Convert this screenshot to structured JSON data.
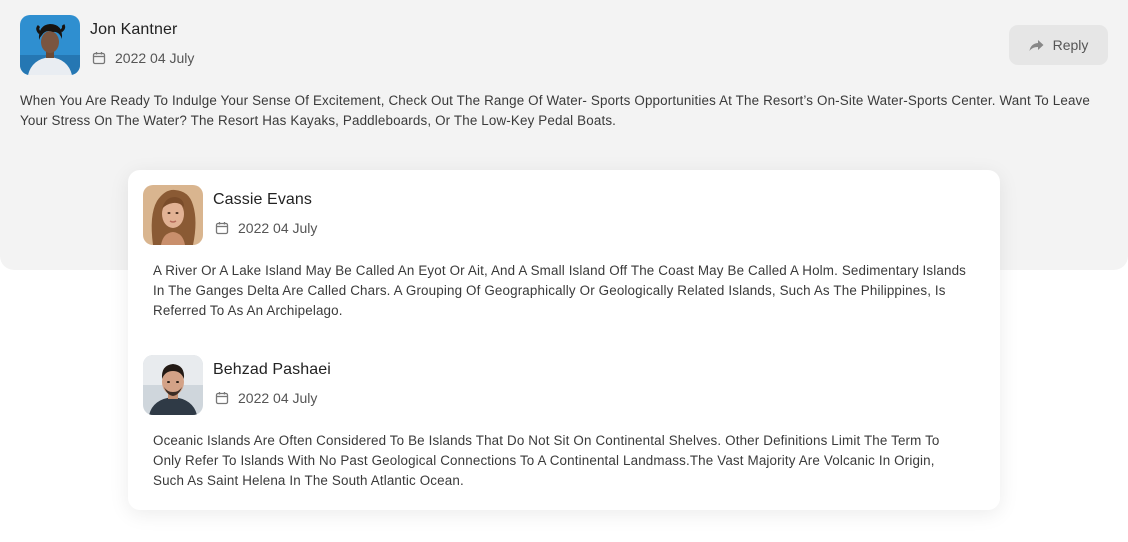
{
  "main_comment": {
    "author": "Jon Kantner",
    "date": "2022 04 July",
    "text": "When You Are Ready To Indulge Your Sense Of Excitement, Check Out The Range Of Water- Sports Opportunities At The Resort’s On-Site Water-Sports Center. Want To Leave Your Stress On The Water? The Resort Has Kayaks, Paddleboards, Or The Low-Key Pedal Boats.",
    "reply_label": "Reply",
    "avatar_icon": "avatar-photo",
    "reply_icon": "share-arrow-icon"
  },
  "replies": [
    {
      "author": "Cassie Evans",
      "date": "2022 04 July",
      "text": "A River Or A Lake Island May Be Called An Eyot Or Ait, And A Small Island Off The Coast May Be Called A Holm. Sedimentary Islands In The Ganges Delta Are Called Chars. A Grouping Of Geographically Or Geologically Related Islands, Such As The Philippines, Is Referred To As An Archipelago."
    },
    {
      "author": "Behzad Pashaei",
      "date": "2022 04 July",
      "text": "Oceanic Islands Are Often Considered To Be Islands That Do Not Sit On Continental Shelves. Other Definitions Limit The Term To Only Refer To Islands With No Past Geological Connections To A Continental Landmass.The Vast Majority Are Volcanic In Origin, Such As Saint Helena In The South Atlantic Ocean."
    }
  ],
  "colors": {
    "main_background": "#f3f3f3",
    "reply_button_background": "#e6e6e6",
    "text": "#3a3a3a"
  }
}
